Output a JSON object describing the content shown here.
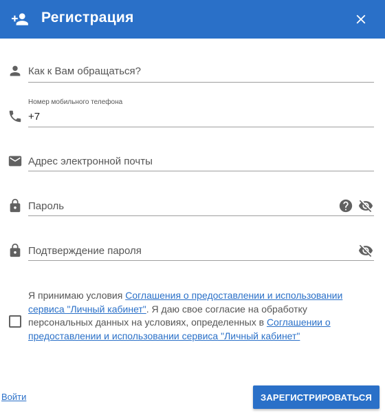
{
  "header": {
    "title": "Регистрация",
    "accent_color": "#2a70c8",
    "icons": [
      "person-add-icon",
      "close-icon"
    ]
  },
  "form": {
    "name": {
      "placeholder": "Как к Вам обращаться?",
      "value": "",
      "icon": "person-icon"
    },
    "phone": {
      "label": "Номер мобильного телефона",
      "value": "+7",
      "icon": "phone-icon"
    },
    "email": {
      "placeholder": "Адрес электронной почты",
      "value": "",
      "icon": "email-icon"
    },
    "password": {
      "placeholder": "Пароль",
      "value": "",
      "icon": "lock-icon",
      "trailing_icons": [
        "help-icon",
        "visibility-off-icon"
      ]
    },
    "password_confirm": {
      "placeholder": "Подтверждение пароля",
      "value": "",
      "icon": "lock-icon",
      "trailing_icons": [
        "visibility-off-icon"
      ]
    }
  },
  "consent": {
    "checked": false,
    "text_1": "Я принимаю условия ",
    "link_1": "Соглашения о предоставлении и использовании сервиса \"Личный кабинет\"",
    "text_2": ". Я даю свое согласие на обработку персональных данных на условиях, определенных в ",
    "link_2": "Соглашении о предоставлении и использовании сервиса \"Личный кабинет\""
  },
  "footer": {
    "login_label": "Войти",
    "register_label": "ЗАРЕГИСТРИРОВАТЬСЯ"
  }
}
